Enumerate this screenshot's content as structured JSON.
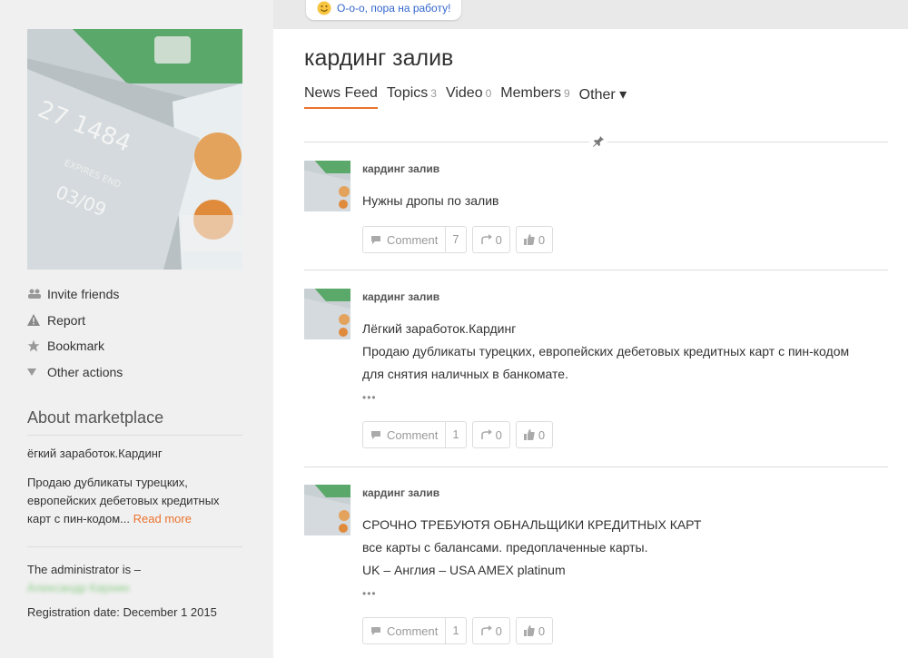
{
  "topbar": {
    "notice": "О-о-о, пора на работу!"
  },
  "sidebar": {
    "actions": [
      {
        "label": "Invite friends",
        "icon": "people-icon"
      },
      {
        "label": "Report",
        "icon": "warning-icon"
      },
      {
        "label": "Bookmark",
        "icon": "star-icon"
      },
      {
        "label": "Other actions",
        "icon": "triangle-down-icon"
      }
    ],
    "about": {
      "title": "About marketplace",
      "line1": "ёгкий заработок.Кардинг",
      "line2": "Продаю дубликаты турецких, европейских дебетовых кредитных карт с пин-кодом...",
      "read_more": "Read more",
      "admin_label": "The administrator is –",
      "admin_name": "Александр Карнин",
      "registration": "Registration date: December 1 2015"
    }
  },
  "main": {
    "title": "кардинг залив",
    "tabs": [
      {
        "label": "News Feed",
        "count": ""
      },
      {
        "label": "Topics",
        "count": "3"
      },
      {
        "label": "Video",
        "count": "0"
      },
      {
        "label": "Members",
        "count": "9"
      },
      {
        "label": "Other ▾",
        "count": ""
      }
    ],
    "posts": [
      {
        "author": "кардинг залив",
        "lines": [
          "Нужны дропы по залив"
        ],
        "comment_label": "Comment",
        "comments": "7",
        "shares": "0",
        "likes": "0"
      },
      {
        "author": "кардинг залив",
        "lines": [
          "Лёгкий заработок.Кардинг",
          "Продаю дубликаты турецких, европейских дебетовых кредитных карт с пин-кодом",
          "для снятия наличных в банкомате."
        ],
        "more": "•••",
        "comment_label": "Comment",
        "comments": "1",
        "shares": "0",
        "likes": "0"
      },
      {
        "author": "кардинг залив",
        "lines": [
          "СРОЧНО ТРЕБУЮТЯ ОБНАЛЬЩИКИ КРЕДИТНЫХ КАРТ",
          "все карты с балансами. предоплаченные карты.",
          "UK – Англия – USA AMEX platinum"
        ],
        "more": "•••",
        "comment_label": "Comment",
        "comments": "1",
        "shares": "0",
        "likes": "0"
      }
    ]
  },
  "colors": {
    "accent": "#eb722e",
    "link": "#3366cc",
    "sidebar_bg": "#f0f0f0"
  }
}
